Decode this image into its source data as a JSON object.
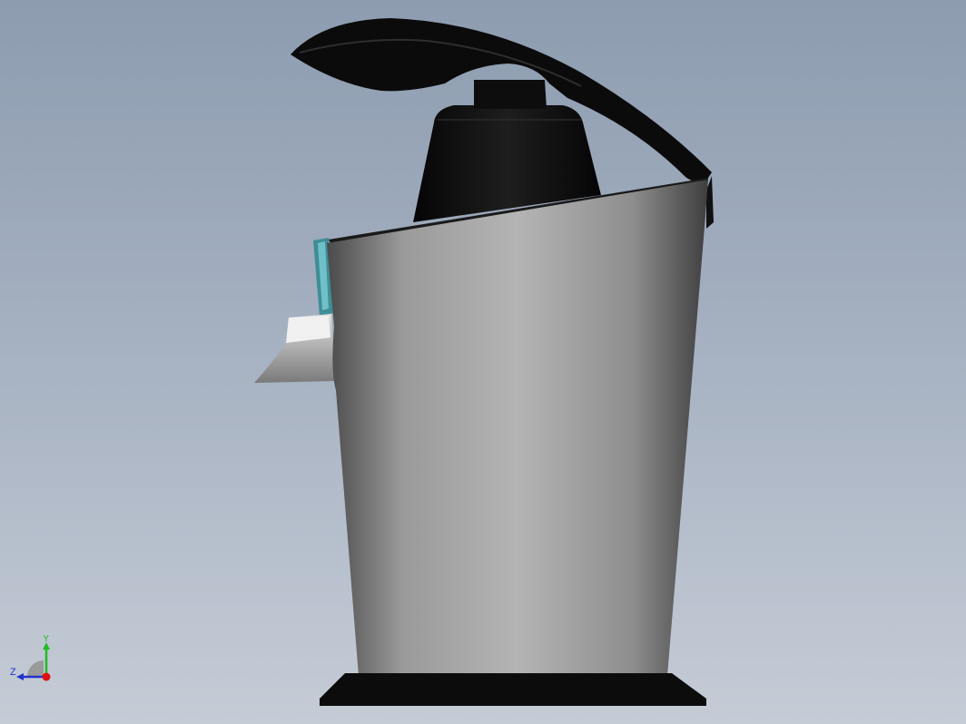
{
  "viewport": {
    "background_top": "#8d9cb0",
    "background_bottom": "#c5ccd6"
  },
  "model": {
    "body_colors": [
      "#4a4a4a",
      "#9a9a9a",
      "#b4b4b4",
      "#8e8e8e",
      "#3e3e3e"
    ],
    "handle_color": "#0b0b0b",
    "spout_color": "#cfcfcf",
    "accent_color": "#3f8e96"
  },
  "triad": {
    "y_label": "Y",
    "z_label": "Z",
    "y_color": "#22bb22",
    "z_color": "#2233cc",
    "x_color": "#dd1111"
  }
}
